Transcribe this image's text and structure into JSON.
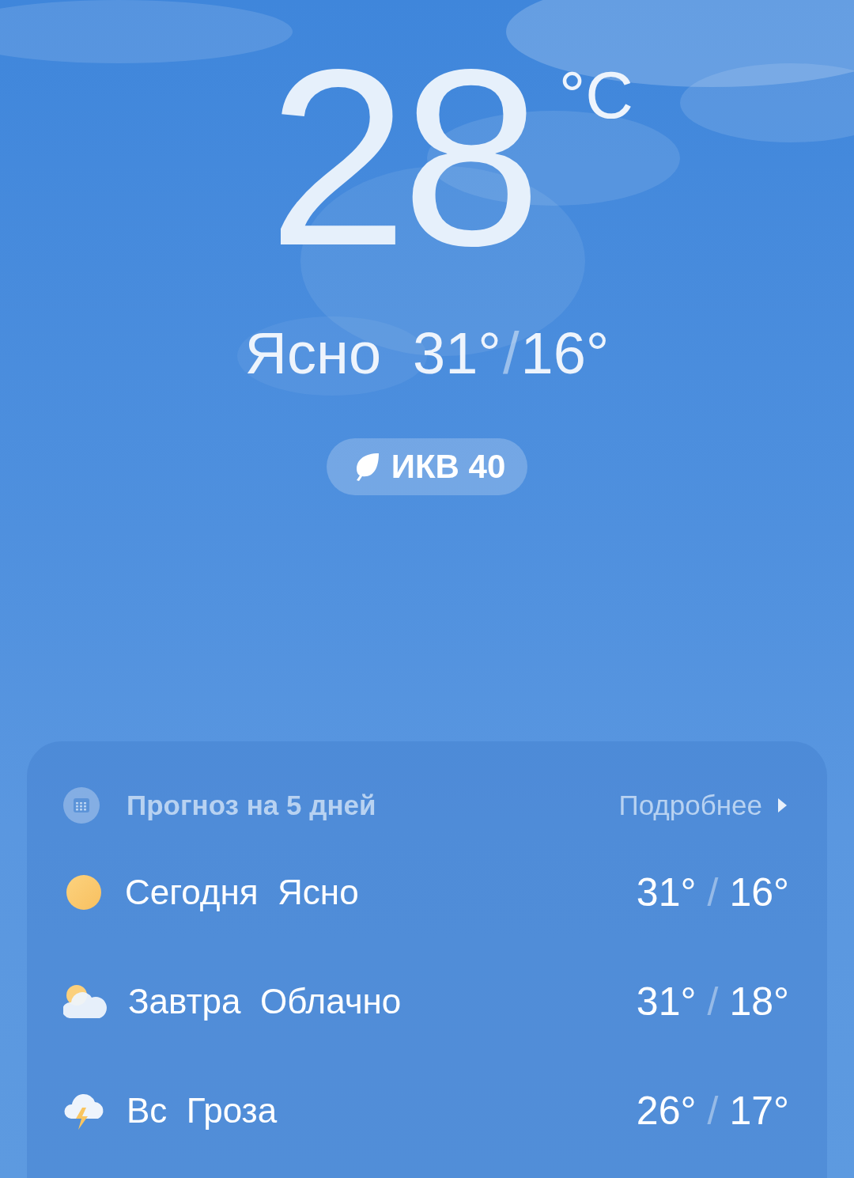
{
  "current": {
    "temperature": "28",
    "unit": "°C",
    "condition": "Ясно",
    "high": "31°",
    "separator": "/",
    "low": "16°"
  },
  "air_quality": {
    "label": "ИКВ 40"
  },
  "forecast": {
    "title": "Прогноз на 5 дней",
    "more": "Подробнее",
    "days": [
      {
        "day": "Сегодня",
        "condition": "Ясно",
        "kind": "sunny",
        "high": "31°",
        "separator": "/",
        "low": "16°"
      },
      {
        "day": "Завтра",
        "condition": "Облачно",
        "kind": "cloudy",
        "high": "31°",
        "separator": "/",
        "low": "18°"
      },
      {
        "day": "Вс",
        "condition": "Гроза",
        "kind": "storm",
        "high": "26°",
        "separator": "/",
        "low": "17°"
      }
    ]
  }
}
